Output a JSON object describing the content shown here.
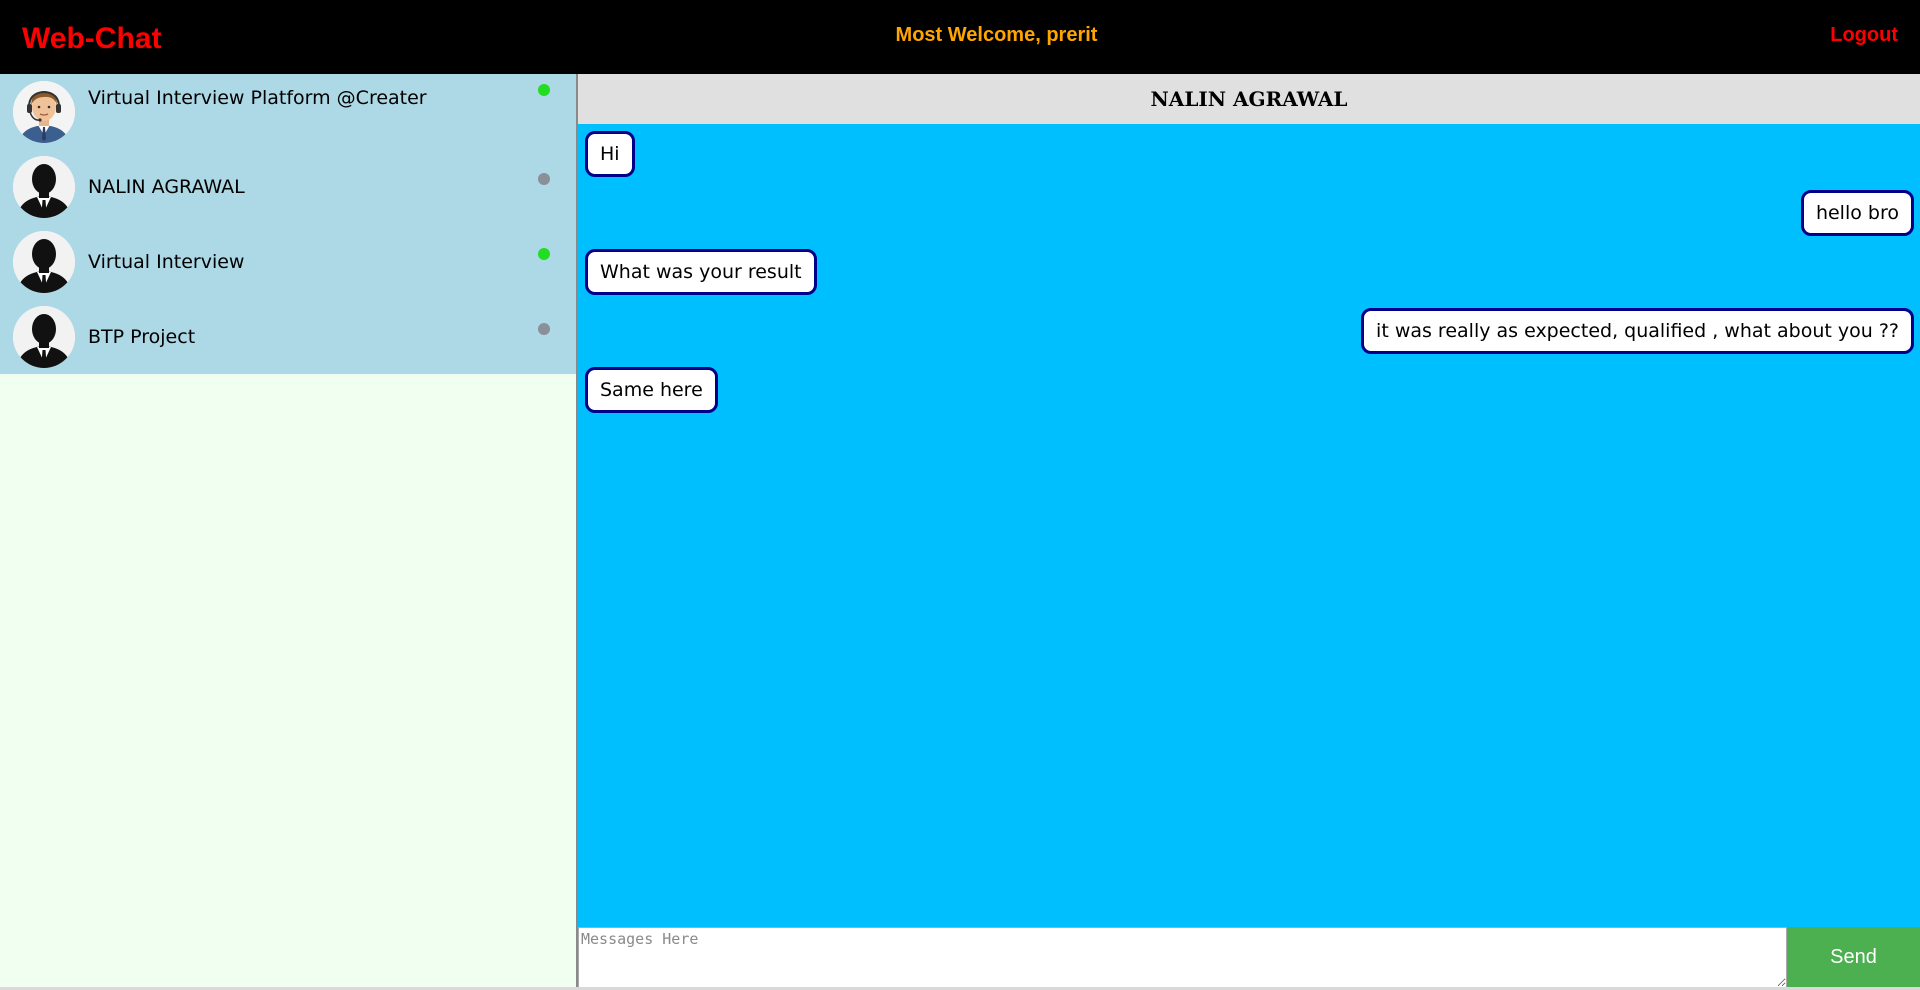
{
  "app": {
    "brand": "Web-Chat",
    "welcome": "Most Welcome, prerit",
    "logout_label": "Logout"
  },
  "colors": {
    "header_bg": "#000000",
    "brand": "#ff0000",
    "welcome": "#ffa500",
    "contact_list_bg": "#add8e6",
    "sidebar_bg": "#f0fff0",
    "chat_header_bg": "#e0e0e0",
    "messages_bg": "#00bfff",
    "bubble_border": "#00008b",
    "send_button": "#4caf50",
    "online": "#22dd22",
    "offline": "#8a8f99"
  },
  "contacts": [
    {
      "name": "Virtual Interview Platform @Creater",
      "status": "online",
      "avatar_icon": "agent-avatar-icon"
    },
    {
      "name": "NALIN AGRAWAL",
      "status": "offline",
      "avatar_icon": "silhouette-avatar-icon"
    },
    {
      "name": "Virtual Interview",
      "status": "online",
      "avatar_icon": "silhouette-avatar-icon"
    },
    {
      "name": "BTP Project",
      "status": "offline",
      "avatar_icon": "silhouette-avatar-icon"
    }
  ],
  "chat": {
    "title": "NALIN AGRAWAL",
    "messages": [
      {
        "text": "Hi",
        "direction": "incoming"
      },
      {
        "text": "hello bro",
        "direction": "outgoing"
      },
      {
        "text": "What was your result",
        "direction": "incoming"
      },
      {
        "text": "it was really as expected, qualified , what about you ??",
        "direction": "outgoing"
      },
      {
        "text": "Same here",
        "direction": "incoming"
      }
    ]
  },
  "composer": {
    "placeholder": "Messages Here",
    "value": "",
    "send_label": "Send"
  }
}
